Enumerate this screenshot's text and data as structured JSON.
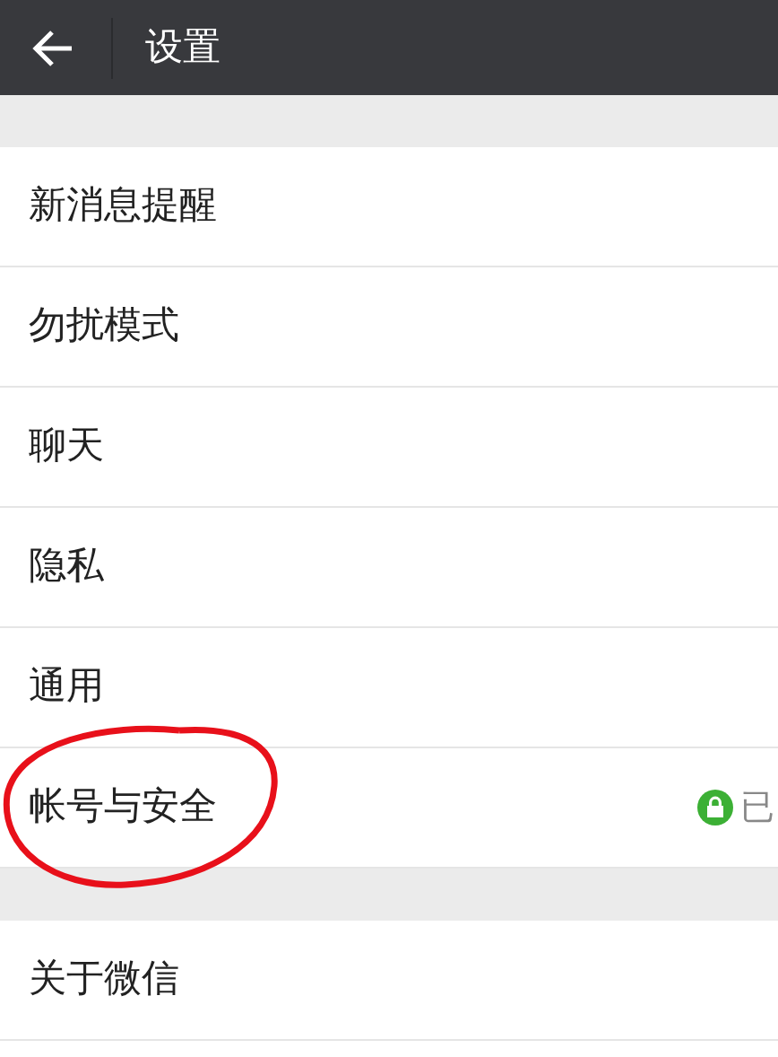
{
  "header": {
    "title": "设置"
  },
  "groups": [
    {
      "items": [
        {
          "label": "新消息提醒"
        },
        {
          "label": "勿扰模式"
        },
        {
          "label": "聊天"
        },
        {
          "label": "隐私"
        },
        {
          "label": "通用"
        },
        {
          "label": "帐号与安全",
          "status": "已",
          "kind": "locked",
          "circled": true
        }
      ]
    },
    {
      "items": [
        {
          "label": "关于微信"
        }
      ]
    }
  ]
}
